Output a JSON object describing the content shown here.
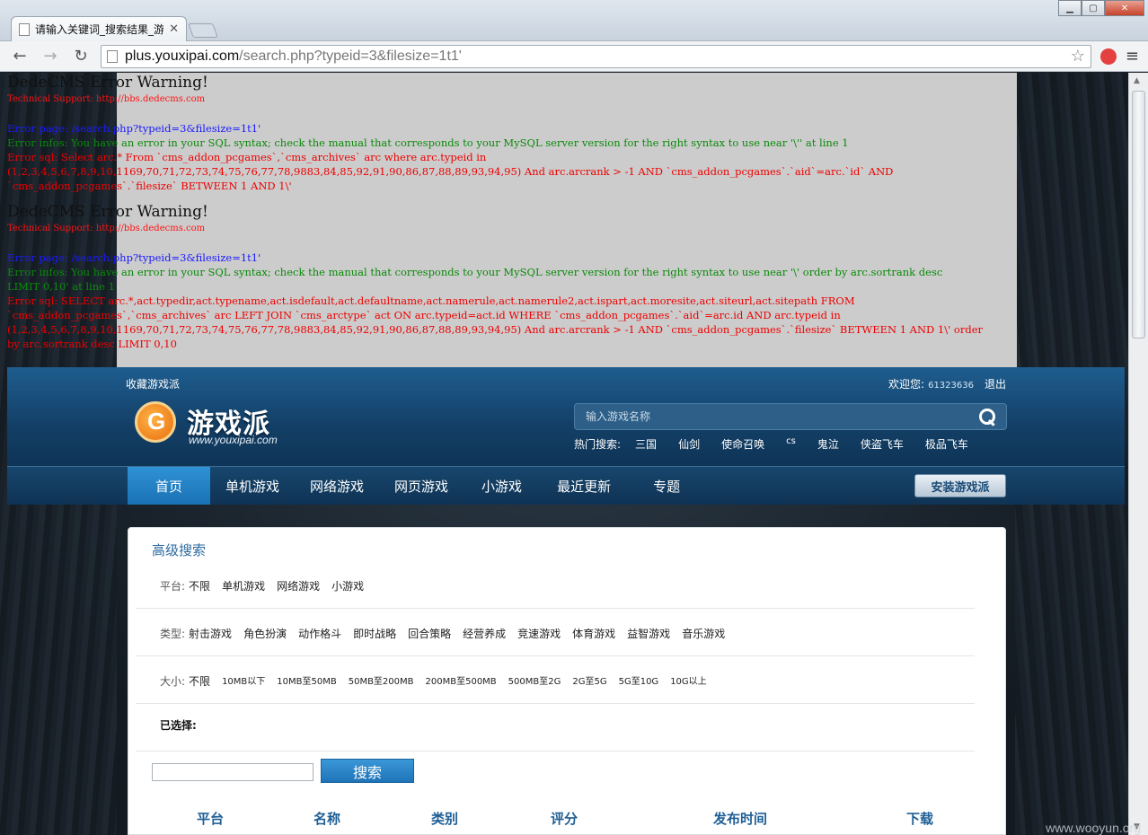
{
  "browser": {
    "tab_title": "请输入关键词_搜索结果_游",
    "url_host": "plus.youxipai.com",
    "url_path": "/search.php?typeid=3&filesize=1t1'"
  },
  "errors": [
    {
      "title": "DedeCMS Error Warning!",
      "support": "Technical Support: http://bbs.dedecms.com",
      "page": "Error page: /search.php?typeid=3&filesize=1t1'",
      "infos": [
        "Error infos: You have an error in your SQL syntax; check the manual that corresponds to your MySQL server version for the right syntax to use near '\\'' at line 1"
      ],
      "sql": [
        "Error sql: Select arc.* From `cms_addon_pcgames`,`cms_archives` arc where arc.typeid in",
        "(1,2,3,4,5,6,7,8,9,10,1169,70,71,72,73,74,75,76,77,78,9883,84,85,92,91,90,86,87,88,89,93,94,95) And arc.arcrank > -1 AND `cms_addon_pcgames`.`aid`=arc.`id` AND",
        "`cms_addon_pcgames`.`filesize` BETWEEN 1 AND 1\\'"
      ]
    },
    {
      "title": "DedeCMS Error Warning!",
      "support": "Technical Support: http://bbs.dedecms.com",
      "page": "Error page: /search.php?typeid=3&filesize=1t1'",
      "infos": [
        "Error infos: You have an error in your SQL syntax; check the manual that corresponds to your MySQL server version for the right syntax to use near '\\' order by arc.sortrank desc",
        "LIMIT 0,10' at line 1"
      ],
      "sql": [
        "Error sql: SELECT arc.*,act.typedir,act.typename,act.isdefault,act.defaultname,act.namerule,act.namerule2,act.ispart,act.moresite,act.siteurl,act.sitepath FROM",
        "`cms_addon_pcgames`,`cms_archives` arc LEFT JOIN `cms_arctype` act ON arc.typeid=act.id WHERE `cms_addon_pcgames`.`aid`=arc.id AND arc.typeid in",
        "(1,2,3,4,5,6,7,8,9,10,1169,70,71,72,73,74,75,76,77,78,9883,84,85,92,91,90,86,87,88,89,93,94,95) And arc.arcrank > -1 AND `cms_addon_pcgames`.`filesize` BETWEEN 1 AND 1\\' order",
        "by arc.sortrank desc LIMIT 0,10"
      ]
    }
  ],
  "header": {
    "fav_link": "收藏游戏派",
    "welcome": "欢迎您:",
    "user_id": "61323636",
    "logout": "退出",
    "logo_text": "游戏派",
    "logo_domain": "www.youxipai.com",
    "search_placeholder": "输入游戏名称",
    "hot_label": "热门搜索:",
    "hot_items": [
      "三国",
      "仙剑",
      "使命召唤",
      "cs",
      "鬼泣",
      "侠盗飞车",
      "极品飞车"
    ]
  },
  "nav": {
    "items": [
      "首页",
      "单机游戏",
      "网络游戏",
      "网页游戏",
      "小游戏",
      "最近更新",
      "专题"
    ],
    "install": "安装游戏派"
  },
  "search": {
    "title": "高级搜索",
    "platform_label": "平台:",
    "platform_options": [
      "不限",
      "单机游戏",
      "网络游戏",
      "小游戏"
    ],
    "type_label": "类型:",
    "type_options": [
      "射击游戏",
      "角色扮演",
      "动作格斗",
      "即时战略",
      "回合策略",
      "经营养成",
      "竞速游戏",
      "体育游戏",
      "益智游戏",
      "音乐游戏"
    ],
    "size_label": "大小:",
    "size_options": [
      "不限",
      "10MB以下",
      "10MB至50MB",
      "50MB至200MB",
      "200MB至500MB",
      "500MB至2G",
      "2G至5G",
      "5G至10G",
      "10G以上"
    ],
    "selected_label": "已选择:",
    "keyword_value": "",
    "button": "搜索",
    "columns": [
      "平台",
      "名称",
      "类别",
      "评分",
      "发布时间",
      "下载"
    ]
  },
  "watermark": "www.wooyun.org"
}
